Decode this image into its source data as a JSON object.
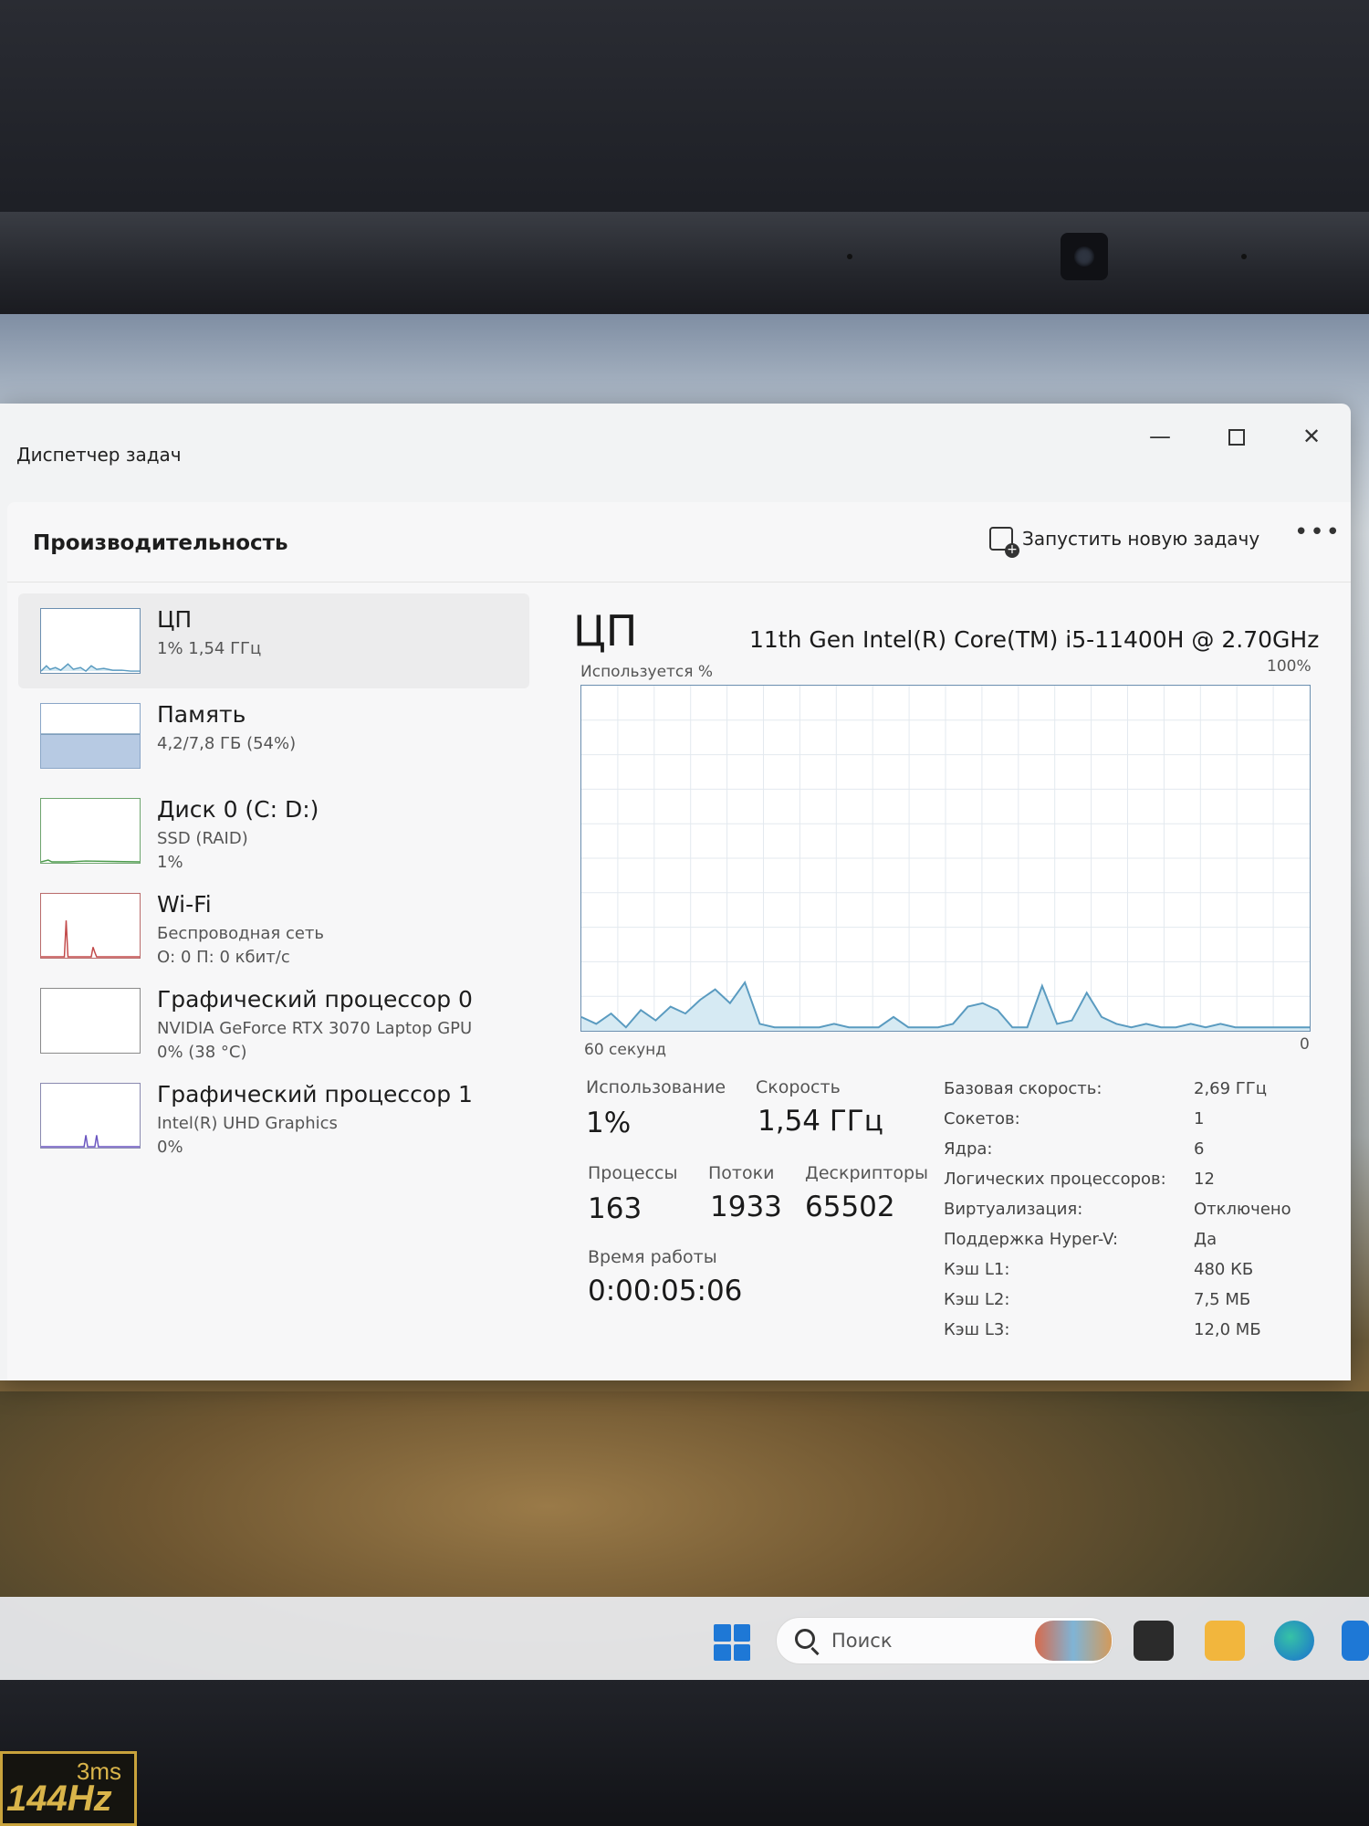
{
  "window": {
    "title": "Диспетчер задач"
  },
  "header": {
    "heading": "Производительность",
    "new_task": "Запустить новую задачу"
  },
  "resources": [
    {
      "name": "ЦП",
      "sub1": "1% 1,54 ГГц",
      "sub2": ""
    },
    {
      "name": "Память",
      "sub1": "4,2/7,8 ГБ (54%)",
      "sub2": ""
    },
    {
      "name": "Диск 0 (C: D:)",
      "sub1": "SSD (RAID)",
      "sub2": "1%"
    },
    {
      "name": "Wi-Fi",
      "sub1": "Беспроводная сеть",
      "sub2": "О: 0 П: 0 кбит/с"
    },
    {
      "name": "Графический процессор 0",
      "sub1": "NVIDIA GeForce RTX 3070 Laptop GPU",
      "sub2": "0% (38 °C)"
    },
    {
      "name": "Графический процессор 1",
      "sub1": "Intel(R) UHD Graphics",
      "sub2": "0%"
    }
  ],
  "panel": {
    "title": "ЦП",
    "model": "11th Gen Intel(R) Core(TM) i5-11400H @ 2.70GHz",
    "graph_label": "Используется %",
    "graph_max": "100%",
    "graph_span": "60 секунд",
    "graph_min": "0"
  },
  "chart_data": {
    "type": "area",
    "ylim": [
      0,
      100
    ],
    "y": [
      4,
      2,
      5,
      1,
      6,
      3,
      7,
      5,
      9,
      12,
      8,
      14,
      2,
      1,
      1,
      1,
      1,
      2,
      1,
      1,
      1,
      4,
      1,
      1,
      1,
      2,
      7,
      8,
      6,
      1,
      1,
      13,
      2,
      3,
      11,
      4,
      2,
      1,
      2,
      1,
      1,
      2,
      1,
      2,
      1,
      1,
      1,
      1,
      1,
      1
    ]
  },
  "stats": {
    "usage_label": "Использование",
    "usage": "1%",
    "speed_label": "Скорость",
    "speed": "1,54 ГГц",
    "processes_label": "Процессы",
    "processes": "163",
    "threads_label": "Потоки",
    "threads": "1933",
    "handles_label": "Дескрипторы",
    "handles": "65502",
    "uptime_label": "Время работы",
    "uptime": "0:00:05:06"
  },
  "specs": [
    {
      "k": "Базовая скорость:",
      "v": "2,69 ГГц"
    },
    {
      "k": "Сокетов:",
      "v": "1"
    },
    {
      "k": "Ядра:",
      "v": "6"
    },
    {
      "k": "Логических процессоров:",
      "v": "12"
    },
    {
      "k": "Виртуализация:",
      "v": "Отключено"
    },
    {
      "k": "Поддержка Hyper-V:",
      "v": "Да"
    },
    {
      "k": "Кэш L1:",
      "v": "480 КБ"
    },
    {
      "k": "Кэш L2:",
      "v": "7,5 МБ"
    },
    {
      "k": "Кэш L3:",
      "v": "12,0 МБ"
    }
  ],
  "taskbar": {
    "search_placeholder": "Поиск"
  },
  "sticker": {
    "ms": "3ms",
    "hz": "144Hz"
  },
  "colors": {
    "graph_line": "#5a9bc0",
    "graph_fill": "#d6eaf3",
    "accent": "#1e78d6"
  }
}
